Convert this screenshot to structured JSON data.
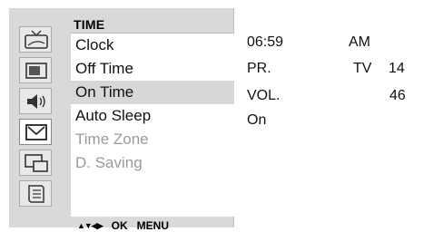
{
  "menu": {
    "title": "TIME",
    "items": [
      {
        "label": "Clock",
        "state": "normal"
      },
      {
        "label": "Off Time",
        "state": "normal"
      },
      {
        "label": "On Time",
        "state": "selected"
      },
      {
        "label": "Auto Sleep",
        "state": "normal"
      },
      {
        "label": "Time Zone",
        "state": "disabled"
      },
      {
        "label": "D. Saving",
        "state": "disabled"
      }
    ]
  },
  "sidebar_icons": [
    "tv-picture-icon",
    "screen-icon",
    "speaker-sound-icon",
    "clock-time-icon",
    "pip-window-icon",
    "book-menu-icon"
  ],
  "footer": {
    "arrows": "▲▼◀▶",
    "ok": "OK",
    "menu": "MENU"
  },
  "info": {
    "clock_time": "06:59",
    "clock_ampm": "AM",
    "program_label": "PR.",
    "program_source": "TV",
    "program_number": "14",
    "volume_label": "VOL.",
    "volume_value": "46",
    "on_time_status": "On"
  },
  "colors": {
    "panel_bg": "#d9d9d9",
    "highlight": "#d7d7d7",
    "disabled_text": "#9a9a9a"
  }
}
